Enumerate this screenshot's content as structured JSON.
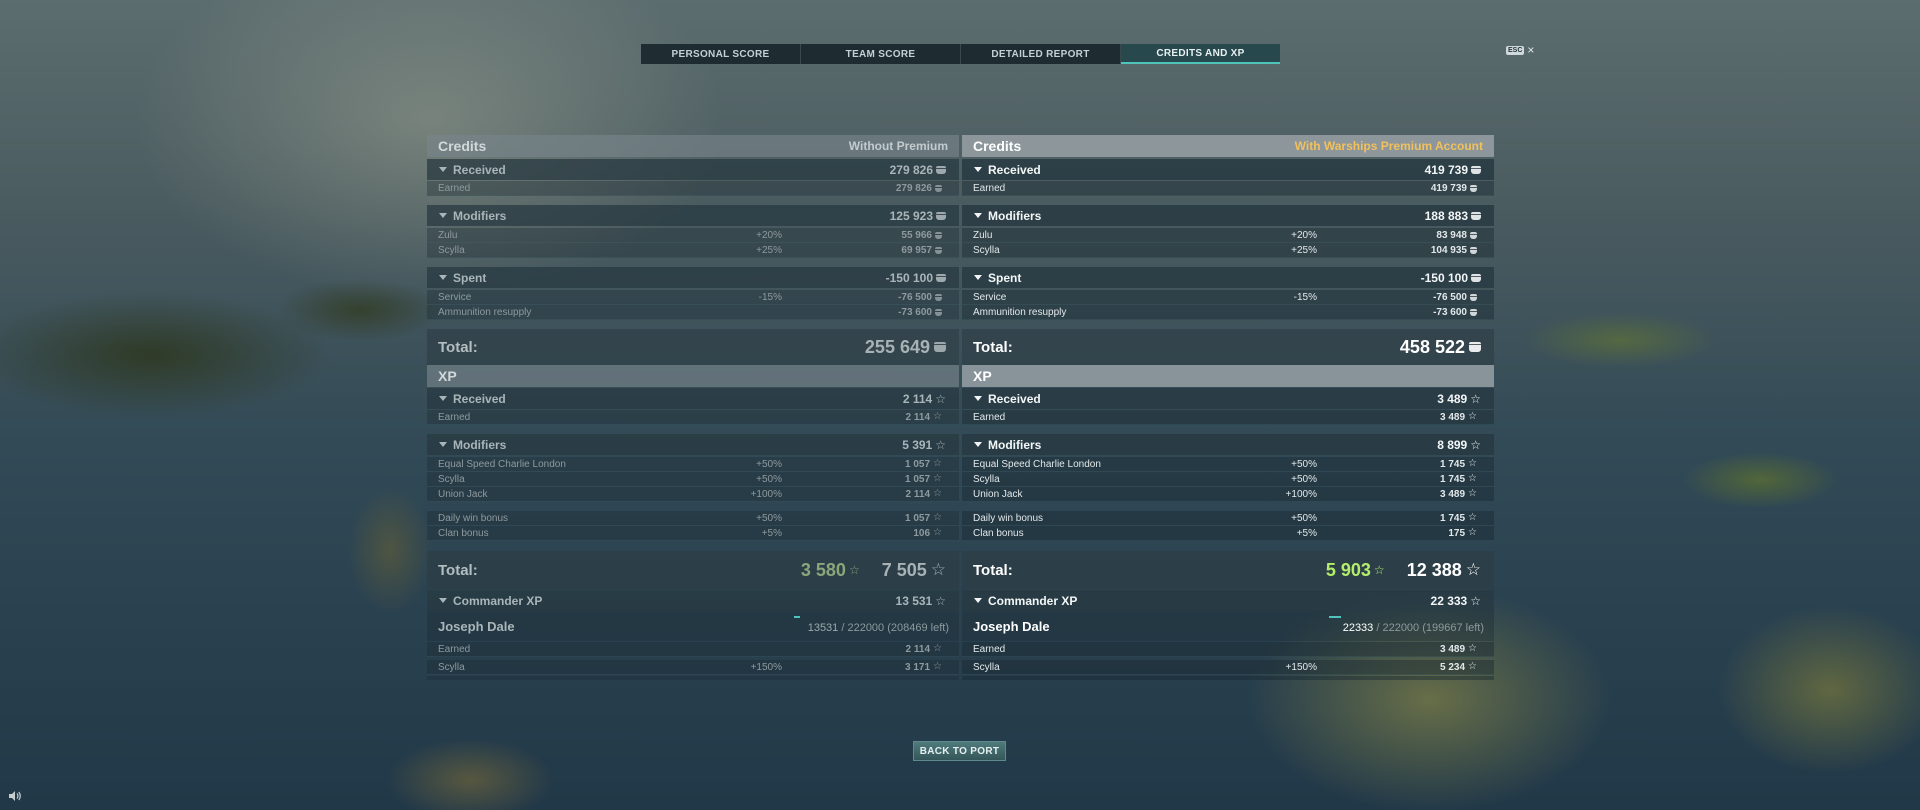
{
  "tabs": [
    {
      "label": "PERSONAL SCORE"
    },
    {
      "label": "TEAM SCORE"
    },
    {
      "label": "DETAILED REPORT"
    },
    {
      "label": "CREDITS AND XP"
    }
  ],
  "esc": {
    "key": "ESC",
    "close": "×"
  },
  "left": {
    "credits_title": "Credits",
    "account": "Without Premium",
    "received": {
      "label": "Received",
      "value": "279 826"
    },
    "earned": {
      "label": "Earned",
      "value": "279 826"
    },
    "modifiers": {
      "label": "Modifiers",
      "value": "125 923"
    },
    "mod_rows": [
      {
        "name": "Zulu",
        "pct": "+20%",
        "value": "55 966"
      },
      {
        "name": "Scylla",
        "pct": "+25%",
        "value": "69 957"
      }
    ],
    "spent": {
      "label": "Spent",
      "value": "-150 100"
    },
    "spent_rows": [
      {
        "name": "Service",
        "pct": "-15%",
        "value": "-76 500"
      },
      {
        "name": "Ammunition resupply",
        "pct": "",
        "value": "-73 600"
      }
    ],
    "credits_total": {
      "label": "Total:",
      "value": "255 649"
    },
    "xp_title": "XP",
    "xp_received": {
      "label": "Received",
      "value": "2 114"
    },
    "xp_earned": {
      "label": "Earned",
      "value": "2 114"
    },
    "xp_modifiers": {
      "label": "Modifiers",
      "value": "5 391"
    },
    "xp_mod_rows": [
      {
        "name": "Equal Speed Charlie London",
        "pct": "+50%",
        "value": "1 057"
      },
      {
        "name": "Scylla",
        "pct": "+50%",
        "value": "1 057"
      },
      {
        "name": "Union Jack",
        "pct": "+100%",
        "value": "2 114"
      }
    ],
    "xp_bonus_rows": [
      {
        "name": "Daily win bonus",
        "pct": "+50%",
        "value": "1 057"
      },
      {
        "name": "Clan bonus",
        "pct": "+5%",
        "value": "106"
      }
    ],
    "xp_total": {
      "label": "Total:",
      "free": "3 580",
      "value": "7 505"
    },
    "commander": {
      "label": "Commander XP",
      "value": "13 531"
    },
    "commander_name": "Joseph Dale",
    "commander_progress": {
      "current": "13531",
      "rest": " / 222000 (208469 left)"
    },
    "cmd_rows": [
      {
        "name": "Earned",
        "pct": "",
        "value": "2 114"
      },
      {
        "name": "Scylla",
        "pct": "+150%",
        "value": "3 171"
      }
    ]
  },
  "right": {
    "credits_title": "Credits",
    "account": "With Warships Premium Account",
    "received": {
      "label": "Received",
      "value": "419 739"
    },
    "earned": {
      "label": "Earned",
      "value": "419 739"
    },
    "modifiers": {
      "label": "Modifiers",
      "value": "188 883"
    },
    "mod_rows": [
      {
        "name": "Zulu",
        "pct": "+20%",
        "value": "83 948"
      },
      {
        "name": "Scylla",
        "pct": "+25%",
        "value": "104 935"
      }
    ],
    "spent": {
      "label": "Spent",
      "value": "-150 100"
    },
    "spent_rows": [
      {
        "name": "Service",
        "pct": "-15%",
        "value": "-76 500"
      },
      {
        "name": "Ammunition resupply",
        "pct": "",
        "value": "-73 600"
      }
    ],
    "credits_total": {
      "label": "Total:",
      "value": "458 522"
    },
    "xp_title": "XP",
    "xp_received": {
      "label": "Received",
      "value": "3 489"
    },
    "xp_earned": {
      "label": "Earned",
      "value": "3 489"
    },
    "xp_modifiers": {
      "label": "Modifiers",
      "value": "8 899"
    },
    "xp_mod_rows": [
      {
        "name": "Equal Speed Charlie London",
        "pct": "+50%",
        "value": "1 745"
      },
      {
        "name": "Scylla",
        "pct": "+50%",
        "value": "1 745"
      },
      {
        "name": "Union Jack",
        "pct": "+100%",
        "value": "3 489"
      }
    ],
    "xp_bonus_rows": [
      {
        "name": "Daily win bonus",
        "pct": "+50%",
        "value": "1 745"
      },
      {
        "name": "Clan bonus",
        "pct": "+5%",
        "value": "175"
      }
    ],
    "xp_total": {
      "label": "Total:",
      "free": "5 903",
      "value": "12 388"
    },
    "commander": {
      "label": "Commander XP",
      "value": "22 333"
    },
    "commander_name": "Joseph Dale",
    "commander_progress": {
      "current": "22333",
      "rest": " / 222000 (199667 left)"
    },
    "cmd_rows": [
      {
        "name": "Earned",
        "pct": "",
        "value": "3 489"
      },
      {
        "name": "Scylla",
        "pct": "+150%",
        "value": "5 234"
      }
    ]
  },
  "back_button": "BACK TO PORT",
  "icons": {
    "credits": "credits-coin-icon",
    "xp": "xp-star-icon",
    "sound": "speaker-icon",
    "collapse": "triangle-down-icon"
  },
  "colors": {
    "premium": "#f1c15c",
    "free_xp": "#b3ee6a",
    "accent": "#4fc4ba"
  }
}
